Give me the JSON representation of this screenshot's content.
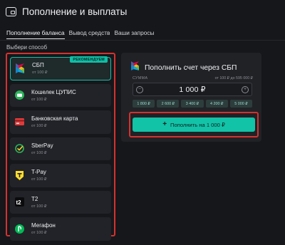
{
  "header": {
    "title": "Пополнение и выплаты",
    "icon": "wallet-icon"
  },
  "tabs": [
    {
      "label": "Пополнение баланса",
      "active": true
    },
    {
      "label": "Вывод средств",
      "active": false
    },
    {
      "label": "Ваши запросы",
      "active": false
    }
  ],
  "methods_label": "Выбери способ",
  "methods": [
    {
      "name": "СБП",
      "min": "от 100 ₽",
      "icon": "sbp-icon",
      "selected": true,
      "badge": "РЕКОМЕНДУЕМ"
    },
    {
      "name": "Кошелек ЦУПИС",
      "min": "от 100 ₽",
      "icon": "cupis-icon",
      "selected": false
    },
    {
      "name": "Банковская карта",
      "min": "от 100 ₽",
      "icon": "bank-card-icon",
      "selected": false
    },
    {
      "name": "SberPay",
      "min": "от 100 ₽",
      "icon": "sberpay-icon",
      "selected": false
    },
    {
      "name": "T-Pay",
      "min": "от 100 ₽",
      "icon": "tpay-icon",
      "selected": false
    },
    {
      "name": "T2",
      "min": "от 100 ₽",
      "icon": "t2-icon",
      "selected": false
    },
    {
      "name": "Мегафон",
      "min": "от 100 ₽",
      "icon": "megafon-icon",
      "selected": false
    }
  ],
  "panel": {
    "title": "Пополнить счет через СБП",
    "sum_label": "СУММА",
    "limits": "от 100 ₽ до 595 000 ₽",
    "amount": "1 000 ₽",
    "presets": [
      "1 800 ₽",
      "2 600 ₽",
      "3 400 ₽",
      "4 200 ₽",
      "5 000 ₽"
    ],
    "submit_label": "Пополнить на 1 000 ₽"
  },
  "colors": {
    "accent": "#12c3a8",
    "highlight": "#d4322f",
    "background": "#16171b",
    "card": "#222328"
  }
}
